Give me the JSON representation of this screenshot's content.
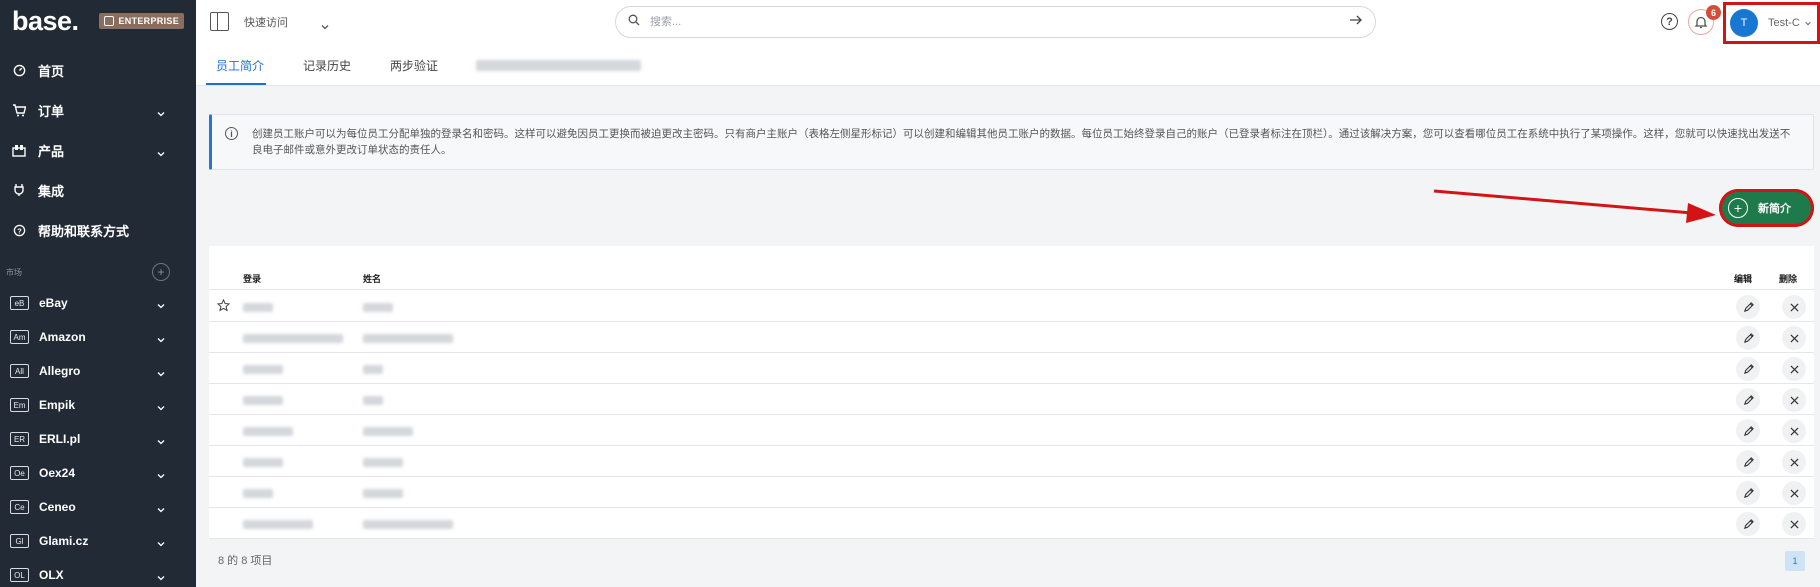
{
  "brand": {
    "logo": "base.",
    "edition": "ENTERPRISE"
  },
  "sidebar": {
    "items": [
      {
        "label": "首页",
        "icon": "dashboard-icon"
      },
      {
        "label": "订单",
        "icon": "cart-icon",
        "expandable": true
      },
      {
        "label": "产品",
        "icon": "products-icon",
        "expandable": true
      },
      {
        "label": "集成",
        "icon": "plug-icon"
      },
      {
        "label": "帮助和联系方式",
        "icon": "help-icon"
      }
    ],
    "section_label": "市场",
    "marketplaces": [
      {
        "tag": "eB",
        "label": "eBay"
      },
      {
        "tag": "Am",
        "label": "Amazon"
      },
      {
        "tag": "All",
        "label": "Allegro"
      },
      {
        "tag": "Em",
        "label": "Empik"
      },
      {
        "tag": "ER",
        "label": "ERLI.pl"
      },
      {
        "tag": "Oe",
        "label": "Oex24"
      },
      {
        "tag": "Ce",
        "label": "Ceneo"
      },
      {
        "tag": "Gl",
        "label": "Glami.cz"
      },
      {
        "tag": "OL",
        "label": "OLX"
      }
    ]
  },
  "topbar": {
    "quick_nav": "快速访问",
    "search_placeholder": "搜索...",
    "notification_count": "6",
    "user_initial": "T",
    "user_name": "Test-C"
  },
  "tabs": [
    "员工简介",
    "记录历史",
    "两步验证"
  ],
  "info": {
    "text": "创建员工账户可以为每位员工分配单独的登录名和密码。这样可以避免因员工更换而被迫更改主密码。只有商户主账户（表格左侧星形标记）可以创建和编辑其他员工账户的数据。每位员工始终登录自己的账户（已登录者标注在顶栏）。通过该解决方案，您可以查看哪位员工在系统中执行了某项操作。这样，您就可以快速找出发送不良电子邮件或意外更改订单状态的责任人。"
  },
  "add_button": {
    "label": "新简介"
  },
  "table": {
    "headers": {
      "login": "登录",
      "name": "姓名",
      "edit": "编辑",
      "delete": "删除"
    },
    "rows": [
      {
        "owner": true
      },
      {
        "owner": false
      },
      {
        "owner": false
      },
      {
        "owner": false
      },
      {
        "owner": false
      },
      {
        "owner": false
      },
      {
        "owner": false
      },
      {
        "owner": false
      }
    ]
  },
  "pagination": {
    "summary": "8 的 8 项目",
    "current_page": "1"
  },
  "colors": {
    "sidebar_bg": "#222a35",
    "accent": "#1f6fd1",
    "add_button": "#1f7a4b",
    "highlight": "#d41414"
  }
}
